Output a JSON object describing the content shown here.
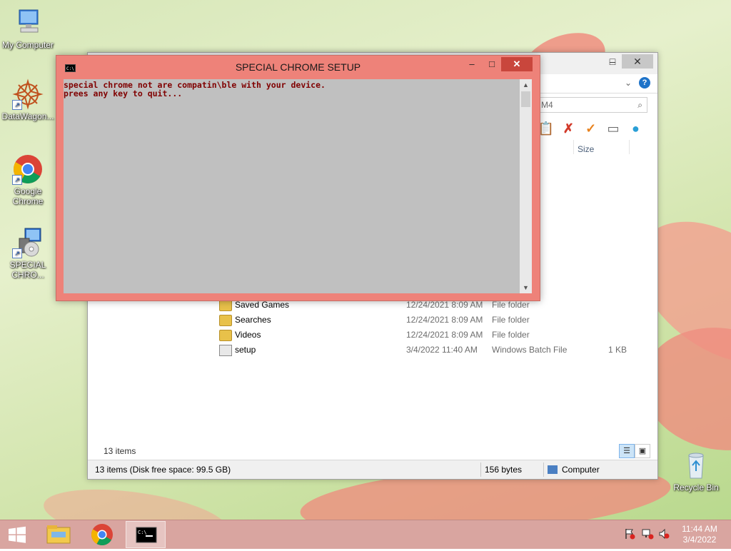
{
  "desktop": {
    "icons": [
      {
        "label": "My Computer"
      },
      {
        "label": "DataWagon..."
      },
      {
        "label": "Google Chrome"
      },
      {
        "label": "SPECIAL CHRO..."
      },
      {
        "label": "Recycle Bin"
      }
    ]
  },
  "explorer": {
    "search_text": "M4",
    "column_size": "Size",
    "rows": [
      {
        "name": "Saved Games",
        "date": "12/24/2021 8:09 AM",
        "type": "File folder",
        "size": ""
      },
      {
        "name": "Searches",
        "date": "12/24/2021 8:09 AM",
        "type": "File folder",
        "size": ""
      },
      {
        "name": "Videos",
        "date": "12/24/2021 8:09 AM",
        "type": "File folder",
        "size": ""
      },
      {
        "name": "setup",
        "date": "3/4/2022 11:40 AM",
        "type": "Windows Batch File",
        "size": "1 KB"
      }
    ],
    "item_count": "13 items",
    "status": {
      "left": "13 items (Disk free space: 99.5 GB)",
      "middle": "156 bytes",
      "right": "Computer"
    }
  },
  "console": {
    "title": "SPECIAL CHROME SETUP",
    "lines": [
      "special chrome not are compatin\\ble with your device.",
      "prees any key to quit..."
    ]
  },
  "taskbar": {
    "clock_time": "11:44 AM",
    "clock_date": "3/4/2022"
  },
  "colors": {
    "console_frame": "#ee8279",
    "console_text": "#800000",
    "console_bg": "#c0c0c0",
    "taskbar": "#d9a5a0"
  }
}
